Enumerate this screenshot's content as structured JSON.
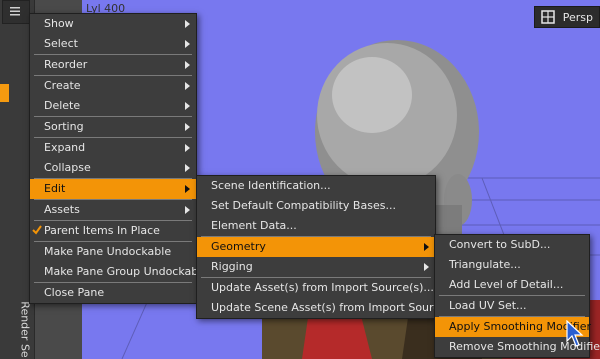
{
  "viewport": {
    "label": "Lyl 400",
    "camera_label": "Persp",
    "background_color": "#7878ef"
  },
  "left_strip": {
    "vertical_tab": "Render Se",
    "accent_color": "#f59a10"
  },
  "menu_main": {
    "items": [
      {
        "label": "Show",
        "submenu": true
      },
      {
        "label": "Select",
        "submenu": true
      },
      {
        "label": "Reorder",
        "submenu": true
      },
      {
        "label": "Create",
        "submenu": true
      },
      {
        "label": "Delete",
        "submenu": true
      },
      {
        "label": "Sorting",
        "submenu": true
      },
      {
        "label": "Expand",
        "submenu": true
      },
      {
        "label": "Collapse",
        "submenu": true
      },
      {
        "label": "Edit",
        "submenu": true,
        "active": true
      },
      {
        "label": "Assets",
        "submenu": true
      },
      {
        "label": "Parent Items In Place",
        "checked": true
      },
      {
        "label": "Make Pane Undockable"
      },
      {
        "label": "Make Pane Group Undockable"
      },
      {
        "label": "Close Pane"
      }
    ]
  },
  "menu_edit": {
    "items": [
      {
        "label": "Scene Identification..."
      },
      {
        "label": "Set Default Compatibility Bases..."
      },
      {
        "label": "Element Data..."
      },
      {
        "label": "Geometry",
        "submenu": true,
        "active": true
      },
      {
        "label": "Rigging",
        "submenu": true
      },
      {
        "label": "Update Asset(s) from Import Source(s)..."
      },
      {
        "label": "Update Scene Asset(s) from Import Source(s)..."
      }
    ]
  },
  "menu_geometry": {
    "items": [
      {
        "label": "Convert to SubD..."
      },
      {
        "label": "Triangulate..."
      },
      {
        "label": "Add Level of Detail..."
      },
      {
        "label": "Load UV Set..."
      },
      {
        "label": "Apply Smoothing Modifier",
        "active": true
      },
      {
        "label": "Remove Smoothing Modifier"
      }
    ]
  },
  "colors": {
    "highlight": "#f39407",
    "menu_bg": "#3d3d3d"
  },
  "icons": [
    "pane-options-icon",
    "camera-view-icon",
    "check-icon",
    "chevron-right-icon",
    "mouse-cursor-icon"
  ]
}
